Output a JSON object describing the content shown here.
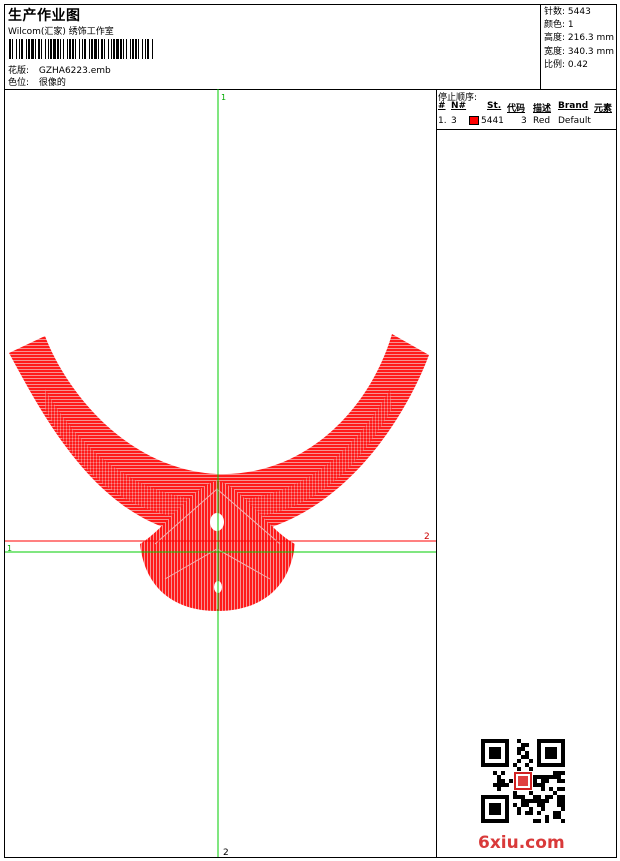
{
  "header": {
    "title": "生产作业图",
    "studio": "Wilcom(汇家) 绣饰工作室",
    "design_label": "花版:",
    "design_value": "GZHA6223.emb",
    "colorway_label": "色位:",
    "colorway_value": "很像的"
  },
  "stats": {
    "stitches": "针数: 5443",
    "colors": "颜色: 1",
    "height": "高度: 216.3 mm",
    "width": "宽度: 340.3 mm",
    "scale": "比例: 0.42"
  },
  "stop_sequence": {
    "title": "停止顺序:",
    "columns": [
      "#",
      "N#",
      "St.",
      "代码",
      "描述",
      "Brand",
      "元素"
    ],
    "rows": [
      {
        "index": "1.",
        "needle": "3",
        "color": "#ff0000",
        "stitches": "5441",
        "code": "3",
        "description": "Red",
        "brand": "Default"
      }
    ]
  },
  "axes": {
    "v_top": "1",
    "v_bottom": "2",
    "h_left": "1",
    "h_right": "2",
    "vertical_color": "#00cc00",
    "horizontal_red": "#ff0000",
    "horizontal_green": "#00cc00"
  },
  "embroidery": {
    "fill_color": "#ff0000"
  },
  "watermark": {
    "text": "6xiu.com",
    "color": "#d93a3a"
  }
}
